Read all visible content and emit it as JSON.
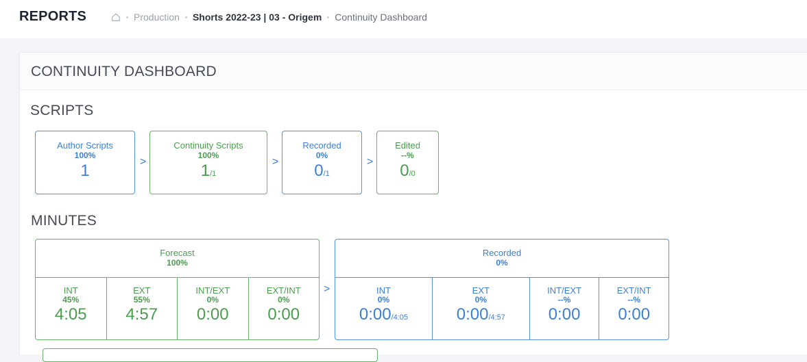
{
  "header": {
    "brand": "REPORTS",
    "breadcrumb": [
      {
        "label": "Production"
      },
      {
        "label": "Shorts 2022-23 | 03 - Origem"
      },
      {
        "label": "Continuity Dashboard"
      }
    ]
  },
  "page": {
    "title": "CONTINUITY DASHBOARD"
  },
  "scripts": {
    "title": "SCRIPTS",
    "cards": [
      {
        "label": "Author Scripts",
        "percent": "100%",
        "value": "1",
        "total": ""
      },
      {
        "label": "Continuity Scripts",
        "percent": "100%",
        "value": "1",
        "total": "/1"
      },
      {
        "label": "Recorded",
        "percent": "0%",
        "value": "0",
        "total": "/1"
      },
      {
        "label": "Edited",
        "percent": "--%",
        "value": "0",
        "total": "/0"
      }
    ]
  },
  "minutes": {
    "title": "MINUTES",
    "forecast": {
      "label": "Forecast",
      "percent": "100%",
      "cells": [
        {
          "name": "INT",
          "percent": "45%",
          "value": "4:05",
          "total": ""
        },
        {
          "name": "EXT",
          "percent": "55%",
          "value": "4:57",
          "total": ""
        },
        {
          "name": "INT/EXT",
          "percent": "0%",
          "value": "0:00",
          "total": ""
        },
        {
          "name": "EXT/INT",
          "percent": "0%",
          "value": "0:00",
          "total": ""
        }
      ]
    },
    "recorded": {
      "label": "Recorded",
      "percent": "0%",
      "cells": [
        {
          "name": "INT",
          "percent": "0%",
          "value": "0:00",
          "total": "/4:05"
        },
        {
          "name": "EXT",
          "percent": "0%",
          "value": "0:00",
          "total": "/4:57"
        },
        {
          "name": "INT/EXT",
          "percent": "--%",
          "value": "0:00",
          "total": ""
        },
        {
          "name": "EXT/INT",
          "percent": "--%",
          "value": "0:00",
          "total": ""
        }
      ]
    }
  },
  "colors": {
    "blue": "#3d7fd6",
    "green": "#4a9d4e",
    "background": "#f2f4f7"
  },
  "icons": {
    "home": "home-icon",
    "next": "chevron-right-icon"
  }
}
